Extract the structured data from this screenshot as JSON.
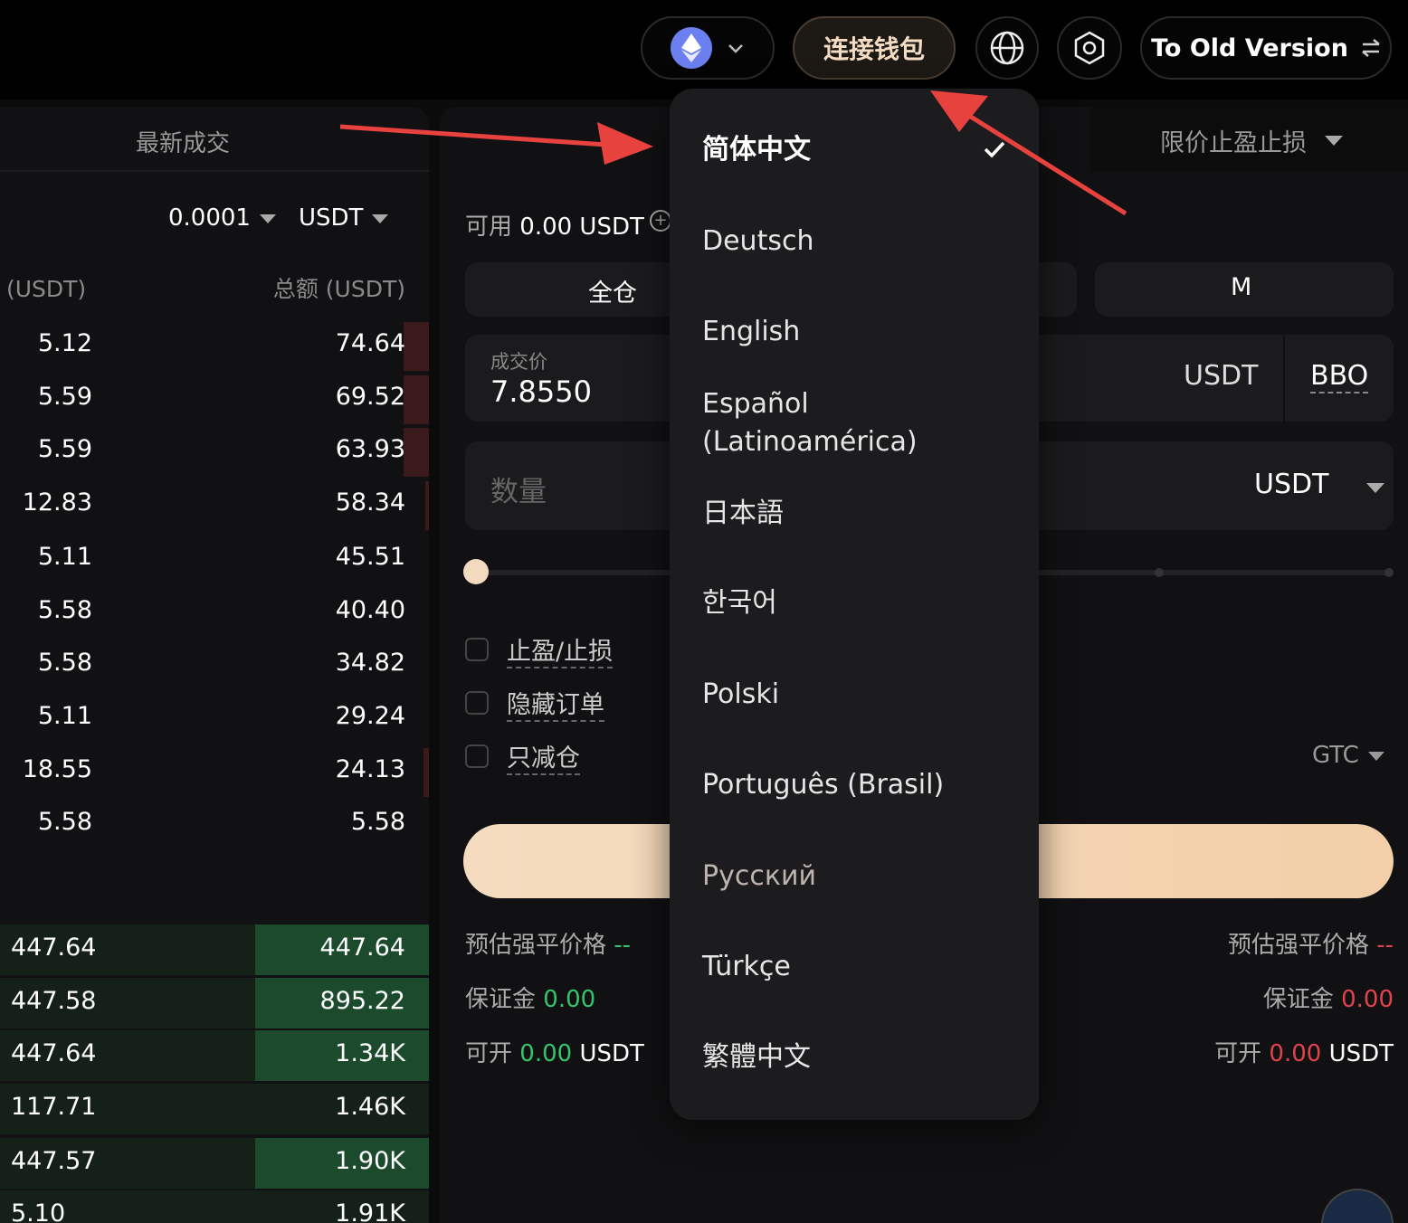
{
  "header": {
    "connect_wallet": "连接钱包",
    "old_version": "To Old Version",
    "icons": [
      "ethereum-icon",
      "chevron-down-icon",
      "globe-icon",
      "settings-icon",
      "swap-icon"
    ]
  },
  "orderbook": {
    "tab": "最新成交",
    "precision": "0.0001",
    "unit": "USDT",
    "col_left": "量 (USDT)",
    "col_right": "总额 (USDT)",
    "asks": [
      {
        "size": "5.12",
        "total": "74.64"
      },
      {
        "size": "5.59",
        "total": "69.52"
      },
      {
        "size": "5.59",
        "total": "63.93"
      },
      {
        "size": "12.83",
        "total": "58.34"
      },
      {
        "size": "5.11",
        "total": "45.51"
      },
      {
        "size": "5.58",
        "total": "40.40"
      },
      {
        "size": "5.58",
        "total": "34.82"
      },
      {
        "size": "5.11",
        "total": "29.24"
      },
      {
        "size": "18.55",
        "total": "24.13"
      },
      {
        "size": "5.58",
        "total": "5.58"
      }
    ],
    "bids": [
      {
        "size": "447.64",
        "total": "447.64"
      },
      {
        "size": "447.58",
        "total": "895.22"
      },
      {
        "size": "447.64",
        "total": "1.34K"
      },
      {
        "size": "117.71",
        "total": "1.46K"
      },
      {
        "size": "447.57",
        "total": "1.90K"
      },
      {
        "size": "5.10",
        "total": "1.91K"
      }
    ]
  },
  "trade": {
    "order_type": "限价止盈止损",
    "available_label": "可用",
    "available_value": "0.00 USDT",
    "margin_mode": "全仓",
    "leverage_mode": "M",
    "price_label": "成交价",
    "price_value": "7.8550",
    "price_unit": "USDT",
    "bbo": "BBO",
    "qty_placeholder": "数量",
    "qty_unit": "USDT",
    "slider_percent": 0,
    "tp_sl": "止盈/止损",
    "hidden_order": "隐藏订单",
    "reduce_only": "只减仓",
    "tif": "GTC",
    "liq_price_label": "预估强平价格",
    "liq_price_value": "--",
    "margin_label": "保证金",
    "margin_value": "0.00",
    "openable_label": "可开",
    "openable_value": "0.00",
    "openable_unit": "USDT"
  },
  "language_menu": {
    "selected": "简体中文",
    "items": [
      "简体中文",
      "Deutsch",
      "English",
      "Español (Latinoamérica)",
      "日本語",
      "한국어",
      "Polski",
      "Português (Brasil)",
      "Русский",
      "Türkçe",
      "繁體中文"
    ]
  },
  "colors": {
    "accent": "#f3d9bd",
    "buy": "#35c46b",
    "sell": "#e0424e",
    "annotation_arrow": "#e8423f"
  }
}
